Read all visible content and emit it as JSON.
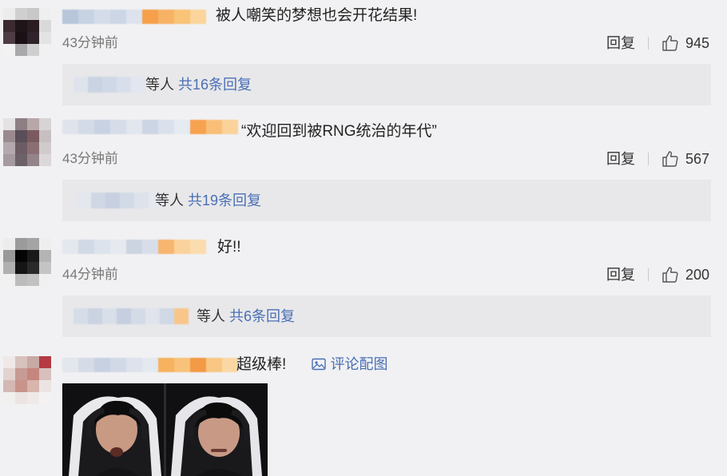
{
  "colors": {
    "background": "#f1f1f3",
    "reply_box": "#e8e8ea",
    "link": "#4a6fb5"
  },
  "actions": {
    "reply_label": "回复"
  },
  "comments": [
    {
      "text": "被人嘲笑的梦想也会开花结果!",
      "time": "43分钟前",
      "likes": "945",
      "replies": {
        "prefix": "等人",
        "count": "共16条回复"
      }
    },
    {
      "text": "“欢迎回到被RNG统治的年代”",
      "time": "43分钟前",
      "likes": "567",
      "replies": {
        "prefix": "等人",
        "count": "共19条回复"
      }
    },
    {
      "text": "好!!",
      "time": "44分钟前",
      "likes": "200",
      "replies": {
        "prefix": "等人",
        "count": "共6条回复"
      }
    },
    {
      "text": "超级棒!",
      "pic_link": "评论配图",
      "pic_icon": "image-icon"
    }
  ]
}
